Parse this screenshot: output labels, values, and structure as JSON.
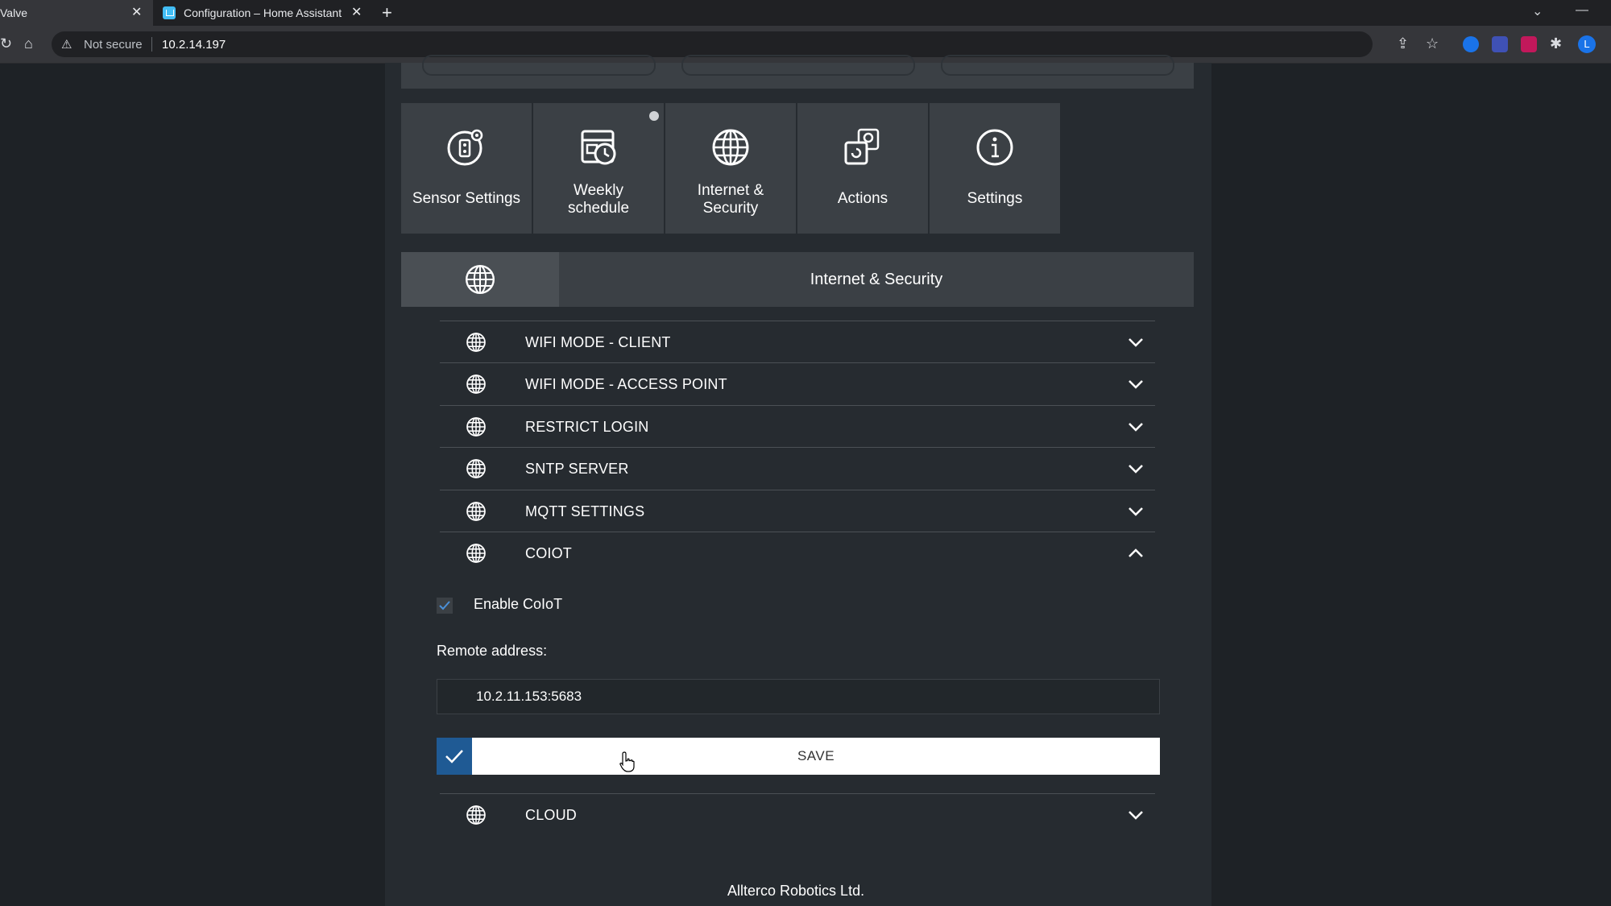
{
  "browser": {
    "tabs": [
      {
        "title": "Valve",
        "active": true
      },
      {
        "title": "Configuration – Home Assistant",
        "active": false
      }
    ],
    "security_label": "Not secure",
    "url": "10.2.14.197",
    "profile_initial": "L"
  },
  "nav": {
    "tiles": [
      {
        "label": "Sensor Settings",
        "icon": "sensor-settings-icon"
      },
      {
        "label": "Weekly schedule",
        "icon": "weekly-schedule-icon"
      },
      {
        "label": "Internet & Security",
        "icon": "globe-icon"
      },
      {
        "label": "Actions",
        "icon": "actions-icon"
      },
      {
        "label": "Settings",
        "icon": "info-icon"
      }
    ]
  },
  "section": {
    "title": "Internet & Security"
  },
  "accordion": [
    {
      "label": "WIFI MODE - CLIENT",
      "expanded": false
    },
    {
      "label": "WIFI MODE - ACCESS POINT",
      "expanded": false
    },
    {
      "label": "RESTRICT LOGIN",
      "expanded": false
    },
    {
      "label": "SNTP SERVER",
      "expanded": false
    },
    {
      "label": "MQTT SETTINGS",
      "expanded": false
    },
    {
      "label": "COIOT",
      "expanded": true
    },
    {
      "label": "CLOUD",
      "expanded": false
    }
  ],
  "coiot": {
    "enable_label": "Enable CoIoT",
    "enabled": true,
    "remote_address_label": "Remote address:",
    "remote_address_value": "10.2.11.153:5683",
    "save_label": "SAVE"
  },
  "footer": {
    "company": "Allterco Robotics Ltd."
  },
  "colors": {
    "page_bg": "#1e2226",
    "panel_bg": "#262b30",
    "tile_bg": "#3b4045",
    "accent": "#1f5a94"
  }
}
